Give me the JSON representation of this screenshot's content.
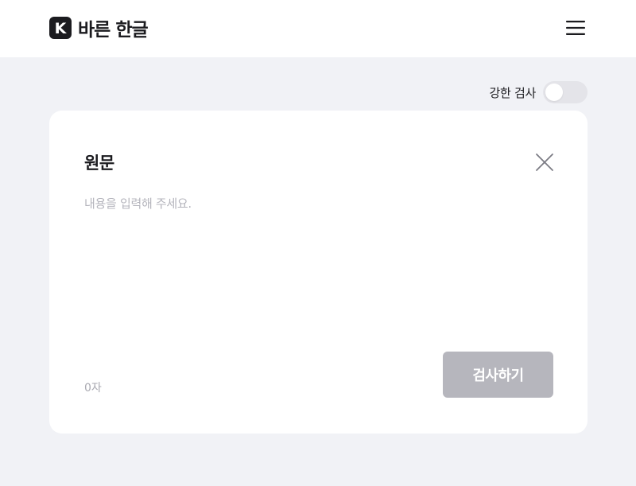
{
  "header": {
    "logo_letter": "K",
    "app_name": "바른 한글",
    "menu_icon": "hamburger-menu-icon"
  },
  "options": {
    "strict_check_label": "강한 검사",
    "strict_check_enabled": false
  },
  "editor": {
    "title": "원문",
    "placeholder": "내용을 입력해 주세요.",
    "value": "",
    "char_count_label": "0자",
    "submit_label": "검사하기",
    "close_icon": "close-icon"
  },
  "colors": {
    "background": "#f1f2f6",
    "surface": "#ffffff",
    "text": "#1b1b1f",
    "placeholder": "#b4b4bc",
    "button_disabled": "#b6b6bd",
    "toggle_off": "#e4e4e9"
  }
}
